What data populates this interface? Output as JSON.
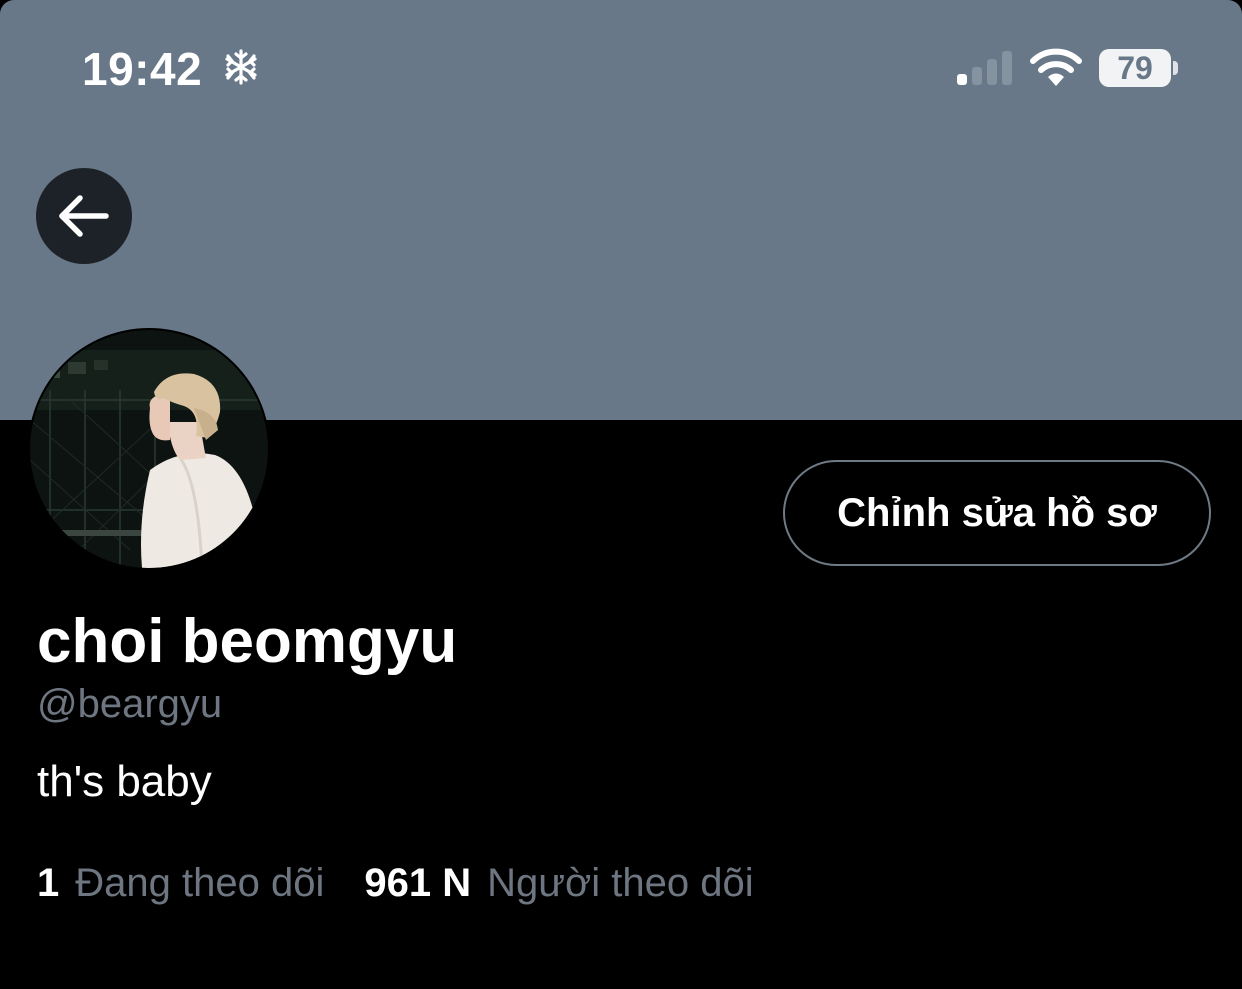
{
  "status_bar": {
    "time": "19:42",
    "battery_level": "79",
    "battery_fraction": 0.79,
    "status_icon": "snowflake-icon",
    "signal_bars_active": 1,
    "signal_bars_total": 4
  },
  "colors": {
    "banner": "#687888",
    "background": "#000000",
    "muted_text": "#6e7681",
    "button_border": "#6f7a85"
  },
  "header": {
    "back_icon": "arrow-left-icon"
  },
  "profile": {
    "edit_button_label": "Chỉnh sửa hồ sơ",
    "display_name": "choi beomgyu",
    "handle": "@beargyu",
    "bio": "th's baby",
    "following_count": "1",
    "following_label": "Đang theo dõi",
    "followers_count": "961 N",
    "followers_label": "Người theo dõi"
  }
}
